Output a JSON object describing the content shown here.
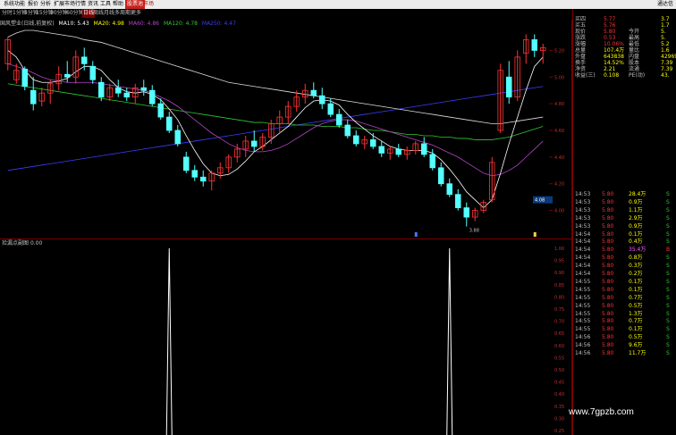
{
  "colors": {
    "up": "#ff3232",
    "down": "#54ffff",
    "ma5": "#ffffff",
    "ma10": "#ffff00",
    "ma20": "#b445c8",
    "ma60": "#32c832",
    "ma120": "#dcdcdc",
    "trend": "#3c3cff",
    "grid": "#7a0000",
    "axis_text": "#c03030"
  },
  "menu": [
    "系统",
    "功能",
    "报价",
    "分析",
    "扩展市场行情",
    "资讯",
    "工具",
    "帮助",
    "股票池",
    "市场"
  ],
  "menu_brand": "通达信",
  "periods": [
    "分时",
    "1分钟",
    "5分钟",
    "15分钟",
    "30分钟",
    "60分钟",
    "日线",
    "周线",
    "月线",
    "多周期",
    "更多"
  ],
  "chart_title": {
    "name": "国风塑业(日线,前复权)",
    "ma5": "MA10: 5.43",
    "ma10": "MA20: 4.98",
    "ma20": "MA60: 4.86",
    "ma60": "MA120: 4.78",
    "ma120": "MA250: 4.47"
  },
  "sub_indicator": {
    "name": "捡漏点副图",
    "value": "0.00"
  },
  "chart_data": {
    "type": "candlestick",
    "y_ticks": [
      "5.20",
      "5.00",
      "4.80",
      "4.60",
      "4.40",
      "4.20",
      "4.00"
    ],
    "y_range": [
      3.85,
      5.35
    ],
    "price_marker": "4.08",
    "low_label": "3.88",
    "candles": [
      [
        5.1,
        5.3,
        5.05,
        5.28
      ],
      [
        4.98,
        5.1,
        4.95,
        5.05
      ],
      [
        5.06,
        5.08,
        4.9,
        4.93
      ],
      [
        4.9,
        5.0,
        4.75,
        4.8
      ],
      [
        4.82,
        4.92,
        4.78,
        4.88
      ],
      [
        4.88,
        4.98,
        4.8,
        4.95
      ],
      [
        4.95,
        5.08,
        4.9,
        5.02
      ],
      [
        5.02,
        5.12,
        4.96,
        5.0
      ],
      [
        5.0,
        5.2,
        4.95,
        5.15
      ],
      [
        5.15,
        5.22,
        5.05,
        5.1
      ],
      [
        5.08,
        5.12,
        4.95,
        4.98
      ],
      [
        4.96,
        5.0,
        4.82,
        4.85
      ],
      [
        4.85,
        4.95,
        4.82,
        4.92
      ],
      [
        4.92,
        4.98,
        4.85,
        4.88
      ],
      [
        4.88,
        4.92,
        4.82,
        4.85
      ],
      [
        4.85,
        4.95,
        4.8,
        4.92
      ],
      [
        4.92,
        4.98,
        4.86,
        4.9
      ],
      [
        4.9,
        4.94,
        4.78,
        4.8
      ],
      [
        4.8,
        4.84,
        4.68,
        4.7
      ],
      [
        4.7,
        4.74,
        4.58,
        4.6
      ],
      [
        4.6,
        4.64,
        4.48,
        4.5
      ],
      [
        4.4,
        4.44,
        4.28,
        4.3
      ],
      [
        4.3,
        4.34,
        4.22,
        4.25
      ],
      [
        4.25,
        4.3,
        4.18,
        4.22
      ],
      [
        4.22,
        4.3,
        4.15,
        4.28
      ],
      [
        4.28,
        4.36,
        4.24,
        4.32
      ],
      [
        4.32,
        4.42,
        4.28,
        4.4
      ],
      [
        4.4,
        4.5,
        4.36,
        4.46
      ],
      [
        4.46,
        4.56,
        4.4,
        4.52
      ],
      [
        4.52,
        4.6,
        4.44,
        4.48
      ],
      [
        4.48,
        4.58,
        4.45,
        4.55
      ],
      [
        4.55,
        4.68,
        4.5,
        4.65
      ],
      [
        4.65,
        4.75,
        4.58,
        4.7
      ],
      [
        4.7,
        4.82,
        4.65,
        4.78
      ],
      [
        4.78,
        4.9,
        4.74,
        4.85
      ],
      [
        4.85,
        4.95,
        4.8,
        4.9
      ],
      [
        4.9,
        4.96,
        4.84,
        4.86
      ],
      [
        4.86,
        4.92,
        4.76,
        4.8
      ],
      [
        4.8,
        4.84,
        4.7,
        4.72
      ],
      [
        4.72,
        4.76,
        4.62,
        4.64
      ],
      [
        4.64,
        4.68,
        4.54,
        4.56
      ],
      [
        4.56,
        4.6,
        4.48,
        4.5
      ],
      [
        4.5,
        4.56,
        4.46,
        4.53
      ],
      [
        4.53,
        4.58,
        4.46,
        4.48
      ],
      [
        4.48,
        4.52,
        4.4,
        4.43
      ],
      [
        4.43,
        4.48,
        4.38,
        4.46
      ],
      [
        4.46,
        4.5,
        4.4,
        4.42
      ],
      [
        4.42,
        4.48,
        4.38,
        4.45
      ],
      [
        4.45,
        4.52,
        4.42,
        4.5
      ],
      [
        4.5,
        4.55,
        4.4,
        4.42
      ],
      [
        4.42,
        4.46,
        4.3,
        4.32
      ],
      [
        4.32,
        4.36,
        4.18,
        4.2
      ],
      [
        4.2,
        4.24,
        4.1,
        4.12
      ],
      [
        4.12,
        4.16,
        4.0,
        4.02
      ],
      [
        4.02,
        4.06,
        3.88,
        3.95
      ],
      [
        3.95,
        4.02,
        3.92,
        4.0
      ],
      [
        4.0,
        4.08,
        3.98,
        4.06
      ],
      [
        4.08,
        4.4,
        4.06,
        4.36
      ],
      [
        4.6,
        5.1,
        4.58,
        5.05
      ],
      [
        5.0,
        5.12,
        4.8,
        4.85
      ],
      [
        4.85,
        5.2,
        4.82,
        5.15
      ],
      [
        5.18,
        5.32,
        5.1,
        5.28
      ],
      [
        5.28,
        5.32,
        5.15,
        5.2
      ],
      [
        5.2,
        5.25,
        5.1,
        5.22
      ]
    ],
    "ma_series": {
      "ma5": [
        5.2,
        5.15,
        5.05,
        4.98,
        4.96,
        4.96,
        4.97,
        4.99,
        5.04,
        5.08,
        5.08,
        5.05,
        4.98,
        4.92,
        4.89,
        4.88,
        4.89,
        4.87,
        4.83,
        4.76,
        4.68,
        4.56,
        4.45,
        4.35,
        4.28,
        4.26,
        4.27,
        4.31,
        4.37,
        4.44,
        4.48,
        4.53,
        4.58,
        4.63,
        4.7,
        4.77,
        4.82,
        4.83,
        4.82,
        4.79,
        4.72,
        4.66,
        4.61,
        4.56,
        4.52,
        4.48,
        4.46,
        4.45,
        4.45,
        4.45,
        4.43,
        4.38,
        4.31,
        4.23,
        4.14,
        4.08,
        4.02,
        4.08,
        4.28,
        4.5,
        4.7,
        4.9,
        5.08,
        5.15
      ],
      "ma20": [
        5.1,
        5.08,
        5.06,
        5.03,
        5.0,
        4.98,
        4.97,
        4.96,
        4.96,
        4.96,
        4.96,
        4.95,
        4.94,
        4.93,
        4.92,
        4.91,
        4.9,
        4.88,
        4.85,
        4.82,
        4.78,
        4.73,
        4.68,
        4.63,
        4.58,
        4.54,
        4.5,
        4.47,
        4.45,
        4.44,
        4.44,
        4.45,
        4.47,
        4.5,
        4.54,
        4.58,
        4.62,
        4.65,
        4.67,
        4.68,
        4.68,
        4.67,
        4.65,
        4.63,
        4.61,
        4.59,
        4.57,
        4.55,
        4.53,
        4.51,
        4.49,
        4.46,
        4.43,
        4.4,
        4.36,
        4.32,
        4.28,
        4.26,
        4.27,
        4.3,
        4.34,
        4.4,
        4.46,
        4.52
      ],
      "ma60": [
        4.95,
        4.94,
        4.93,
        4.92,
        4.91,
        4.9,
        4.89,
        4.88,
        4.87,
        4.86,
        4.85,
        4.84,
        4.83,
        4.82,
        4.81,
        4.8,
        4.79,
        4.78,
        4.77,
        4.76,
        4.75,
        4.74,
        4.73,
        4.72,
        4.71,
        4.7,
        4.69,
        4.68,
        4.67,
        4.66,
        4.66,
        4.65,
        4.65,
        4.65,
        4.64,
        4.64,
        4.64,
        4.63,
        4.63,
        4.63,
        4.62,
        4.62,
        4.61,
        4.6,
        4.6,
        4.59,
        4.58,
        4.57,
        4.57,
        4.56,
        4.56,
        4.55,
        4.55,
        4.54,
        4.54,
        4.53,
        4.53,
        4.53,
        4.54,
        4.55,
        4.57,
        4.59,
        4.61,
        4.63
      ],
      "ma120": [
        5.3,
        5.33,
        5.35,
        5.35,
        5.34,
        5.33,
        5.32,
        5.31,
        5.3,
        5.28,
        5.27,
        5.26,
        5.24,
        5.22,
        5.2,
        5.18,
        5.16,
        5.14,
        5.12,
        5.1,
        5.08,
        5.06,
        5.04,
        5.02,
        5.0,
        4.98,
        4.96,
        4.95,
        4.94,
        4.93,
        4.92,
        4.91,
        4.9,
        4.89,
        4.88,
        4.87,
        4.86,
        4.85,
        4.84,
        4.83,
        4.82,
        4.81,
        4.8,
        4.79,
        4.78,
        4.77,
        4.76,
        4.75,
        4.74,
        4.73,
        4.72,
        4.71,
        4.7,
        4.69,
        4.68,
        4.67,
        4.66,
        4.65,
        4.65,
        4.66,
        4.67,
        4.68,
        4.69,
        4.7
      ],
      "trend": [
        4.3,
        4.31,
        4.32,
        4.33,
        4.34,
        4.35,
        4.36,
        4.37,
        4.38,
        4.39,
        4.4,
        4.41,
        4.42,
        4.43,
        4.44,
        4.45,
        4.46,
        4.47,
        4.48,
        4.49,
        4.5,
        4.51,
        4.52,
        4.53,
        4.54,
        4.55,
        4.56,
        4.57,
        4.58,
        4.59,
        4.6,
        4.61,
        4.62,
        4.63,
        4.64,
        4.65,
        4.66,
        4.67,
        4.68,
        4.69,
        4.7,
        4.71,
        4.72,
        4.73,
        4.74,
        4.75,
        4.76,
        4.77,
        4.78,
        4.79,
        4.8,
        4.81,
        4.82,
        4.83,
        4.84,
        4.85,
        4.86,
        4.87,
        4.88,
        4.89,
        4.9,
        4.91,
        4.92,
        4.93
      ]
    },
    "sub_y_ticks": [
      "1.00",
      "0.95",
      "0.90",
      "0.85",
      "0.80",
      "0.75",
      "0.70",
      "0.65",
      "0.60",
      "0.55",
      "0.50",
      "0.45",
      "0.40",
      "0.35",
      "0.30",
      "0.25"
    ],
    "signals": [
      {
        "bar": 19,
        "value": 1.0
      },
      {
        "bar": 52,
        "value": 1.0
      }
    ]
  },
  "quote": {
    "rows": [
      {
        "label": "买四",
        "v1": "5.77",
        "v2": "",
        "v3": "3.7"
      },
      {
        "label": "买五",
        "v1": "5.76",
        "v2": "",
        "v3": "1.7"
      },
      {
        "label": "现价",
        "v1": "5.80",
        "v2": "今开",
        "v3": "5."
      },
      {
        "label": "涨跌",
        "v1": "0.53",
        "v2": "最高",
        "v3": "5."
      },
      {
        "label": "涨幅",
        "v1": "10.06%",
        "v2": "最低",
        "v3": "5.2"
      },
      {
        "label": "总量",
        "v1": "107.4万",
        "v2": "量比",
        "v3": "1.6"
      },
      {
        "label": "外盘",
        "v1": "643838",
        "v2": "内盘",
        "v3": "42969"
      },
      {
        "label": "换手",
        "v1": "14.52%",
        "v2": "股本",
        "v3": "7.39"
      },
      {
        "label": "净资",
        "v1": "2.21",
        "v2": "流通",
        "v3": "7.39"
      },
      {
        "label": "收益(三)",
        "v1": "0.108",
        "v2": "PE(动)",
        "v3": "43."
      }
    ],
    "ticks": [
      {
        "t": "14:53",
        "p": "5.80",
        "v": "28.4万",
        "f": "S"
      },
      {
        "t": "14:53",
        "p": "5.80",
        "v": "0.9万",
        "f": "S"
      },
      {
        "t": "14:53",
        "p": "5.80",
        "v": "1.1万",
        "f": "S"
      },
      {
        "t": "14:53",
        "p": "5.80",
        "v": "2.9万",
        "f": "S"
      },
      {
        "t": "14:53",
        "p": "5.80",
        "v": "0.9万",
        "f": "S"
      },
      {
        "t": "14:54",
        "p": "5.80",
        "v": "0.1万",
        "f": "S"
      },
      {
        "t": "14:54",
        "p": "5.80",
        "v": "0.4万",
        "f": "S"
      },
      {
        "t": "14:54",
        "p": "5.80",
        "v": "35.4万",
        "f": "B"
      },
      {
        "t": "14:54",
        "p": "5.80",
        "v": "0.8万",
        "f": "S"
      },
      {
        "t": "14:54",
        "p": "5.80",
        "v": "0.3万",
        "f": "S"
      },
      {
        "t": "14:54",
        "p": "5.80",
        "v": "0.2万",
        "f": "S"
      },
      {
        "t": "14:55",
        "p": "5.80",
        "v": "0.1万",
        "f": "S"
      },
      {
        "t": "14:55",
        "p": "5.80",
        "v": "0.1万",
        "f": "S"
      },
      {
        "t": "14:55",
        "p": "5.80",
        "v": "0.7万",
        "f": "S"
      },
      {
        "t": "14:55",
        "p": "5.80",
        "v": "0.5万",
        "f": "S"
      },
      {
        "t": "14:55",
        "p": "5.80",
        "v": "1.3万",
        "f": "S"
      },
      {
        "t": "14:55",
        "p": "5.80",
        "v": "0.7万",
        "f": "S"
      },
      {
        "t": "14:55",
        "p": "5.80",
        "v": "0.1万",
        "f": "S"
      },
      {
        "t": "14:56",
        "p": "5.80",
        "v": "0.5万",
        "f": "S"
      },
      {
        "t": "14:56",
        "p": "5.80",
        "v": "9.6万",
        "f": "S"
      },
      {
        "t": "14:56",
        "p": "5.80",
        "v": "11.7万",
        "f": "S"
      }
    ]
  },
  "watermark": "www.7gpzb.com"
}
